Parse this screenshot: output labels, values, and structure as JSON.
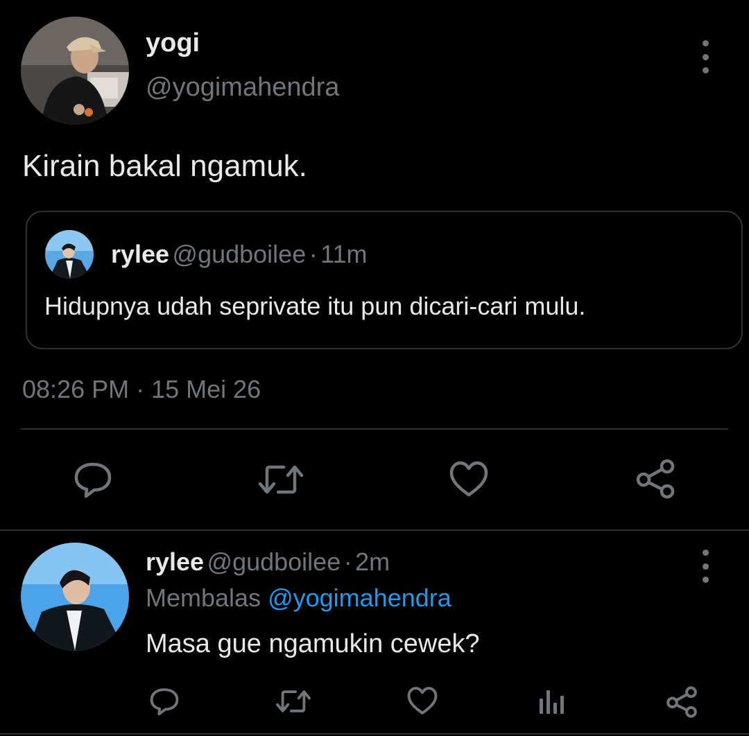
{
  "main_tweet": {
    "author": {
      "display_name": "yogi",
      "handle": "@yogimahendra"
    },
    "text": "Kirain bakal ngamuk.",
    "quoted_tweet": {
      "display_name": "rylee",
      "handle": "@gudboilee",
      "separator": "·",
      "time_ago": "11m",
      "text": "Hidupnya udah seprivate itu pun dicari-cari mulu."
    },
    "timestamp": "08:26 PM · 15 Mei 26",
    "actions": [
      "reply-icon",
      "retweet-icon",
      "like-icon",
      "share-icon"
    ]
  },
  "reply_tweet": {
    "display_name": "rylee",
    "handle": "@gudboilee",
    "separator": "·",
    "time_ago": "2m",
    "replying_label": "Membalas",
    "replying_to": "@yogimahendra",
    "text": "Masa gue ngamukin cewek?",
    "actions": [
      "reply-icon",
      "retweet-icon",
      "like-icon",
      "analytics-icon",
      "share-icon"
    ]
  },
  "colors": {
    "background": "#000000",
    "text_primary": "#e7e9ea",
    "text_secondary": "#71767b",
    "accent": "#1d9bf0",
    "border": "#2f3336"
  }
}
